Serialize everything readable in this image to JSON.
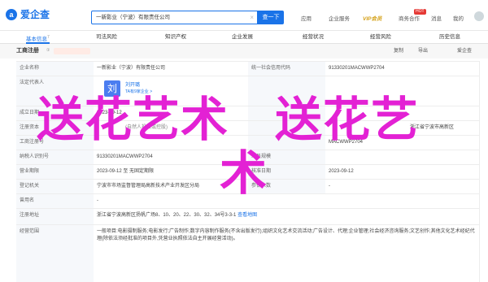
{
  "header": {
    "logo_text": "爱企查",
    "search_value": "一新影业（宁波）有限责任公司",
    "search_button": "查一下",
    "nav": [
      "应用",
      "企业服务",
      "VIP会员",
      "商务合作",
      "HOT",
      "消息",
      "我的"
    ],
    "vip_label": "VIP会员",
    "hot_label": "HOT"
  },
  "tabs": [
    {
      "label": "基本信息",
      "count": "7"
    },
    {
      "label": "司法风险",
      "count": ""
    },
    {
      "label": "知识产权",
      "count": ""
    },
    {
      "label": "企业发展",
      "count": ""
    },
    {
      "label": "经营状况",
      "count": ""
    },
    {
      "label": "经营风险",
      "count": ""
    },
    {
      "label": "历史信息",
      "count": ""
    }
  ],
  "section": {
    "title": "工商注册",
    "tag": "①",
    "actions": [
      "复制",
      "导出",
      "爱企查"
    ]
  },
  "table": {
    "r1": {
      "l1": "企业名称",
      "v1": "一新影业（宁波）有限责任公司",
      "l2": "统一社会信用代码",
      "v2": "91330201MACWWP2704"
    },
    "r2": {
      "l1": "法定代表人",
      "rep_initial": "刘",
      "rep_name": "刘开璐",
      "rep_sub": "TA有9家企业 >"
    },
    "r3": {
      "l1": "成立日期",
      "v1": "2023-09-12"
    },
    "r4": {
      "l1": "注册资本",
      "v1": "(自然人投资或控股)",
      "v2": "浙江省宁波市高新区"
    },
    "r5": {
      "l1": "工商注册号",
      "v1": "",
      "v2": "MACWWP2704"
    },
    "r6": {
      "l1": "纳税人识别号",
      "v1": "91330201MACWWP2704",
      "l2": "人员规模",
      "v2": ""
    },
    "r7": {
      "l1": "营业期限",
      "v1": "2023-09-12 至 无固定期限",
      "l2": "核准日期",
      "v2": "2023-09-12"
    },
    "r8": {
      "l1": "登记机关",
      "v1": "宁波市市场监督管理局高新技术产业开发区分局",
      "l2": "参保人数",
      "v2": "-"
    },
    "r9": {
      "l1": "曾用名",
      "v1": "-"
    },
    "r10": {
      "l1": "注册地址",
      "v1": "浙江省宁波高新区扬帆广场8、10、20、22、30、32、34号3-3-1",
      "link": "查看地图"
    },
    "r11": {
      "l1": "经营范围",
      "v1": "一般项目:电影摄制服务;电影发行;广告制作;数字内容制作服务(不含出版发行);组织文化艺术交流活动;广告设计、代理;企业管理;社会经济咨询服务;文艺创作;其他文化艺术经纪代理(除依法须经批准的项目外,凭营业执照依法自主开展经营活动)。"
    }
  },
  "watermark": {
    "line1": "送花艺术",
    "line2": "送花艺",
    "line3": "术"
  },
  "colors": {
    "accent": "#1a73e8",
    "watermark": "#e321d4"
  }
}
